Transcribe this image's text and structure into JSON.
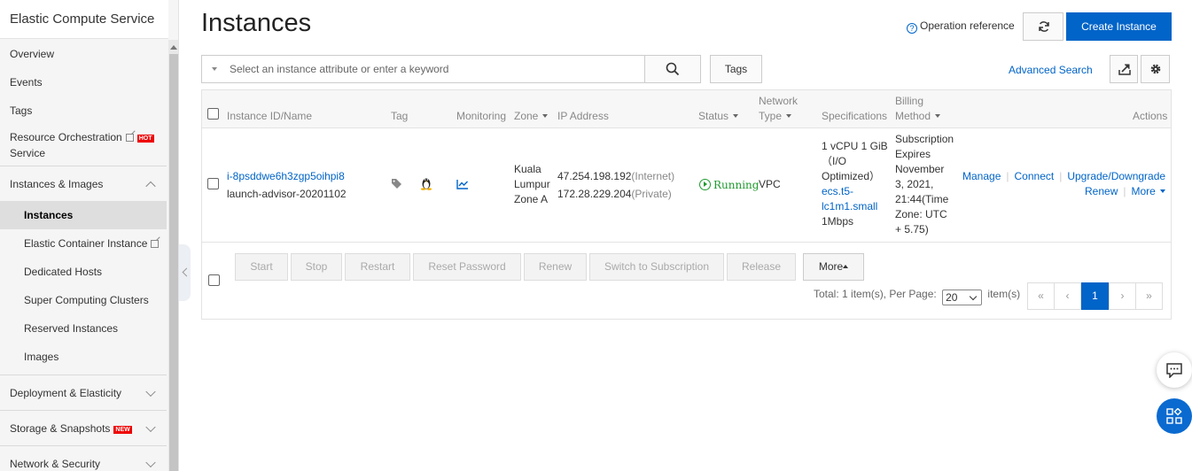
{
  "sidebar": {
    "title": "Elastic Compute Service",
    "items": [
      {
        "label": "Overview"
      },
      {
        "label": "Events"
      },
      {
        "label": "Tags"
      },
      {
        "label": "Resource Orchestration Service",
        "badge": "HOT"
      }
    ],
    "section_instances": {
      "label": "Instances & Images"
    },
    "sub_items": [
      {
        "label": "Instances"
      },
      {
        "label": "Elastic Container Instance"
      },
      {
        "label": "Dedicated Hosts"
      },
      {
        "label": "Super Computing Clusters"
      },
      {
        "label": "Reserved Instances"
      },
      {
        "label": "Images"
      }
    ],
    "section_deployment": {
      "label": "Deployment & Elasticity"
    },
    "section_storage": {
      "label": "Storage & Snapshots",
      "badge": "NEW"
    },
    "section_network": {
      "label": "Network & Security"
    }
  },
  "header": {
    "title": "Instances",
    "operation_reference": "Operation reference",
    "create_instance": "Create Instance"
  },
  "search": {
    "placeholder": "Select an instance attribute or enter a keyword",
    "tags_label": "Tags",
    "advanced_search": "Advanced Search"
  },
  "table": {
    "columns": {
      "instance": "Instance ID/Name",
      "tag": "Tag",
      "monitoring": "Monitoring",
      "zone": "Zone",
      "ip": "IP Address",
      "status": "Status",
      "network_1": "Network",
      "network_2": "Type",
      "specs": "Specifications",
      "billing_1": "Billing",
      "billing_2": "Method",
      "actions": "Actions"
    },
    "row": {
      "instance_id": "i-8psddwe6h3zgp5oihpi8",
      "instance_name": "launch-advisor-20201102",
      "zone_1": "Kuala",
      "zone_2": "Lumpur",
      "zone_3": "Zone A",
      "ip_public": "47.254.198.192",
      "ip_public_tag": "(Internet)",
      "ip_private": "172.28.229.204",
      "ip_private_tag": "(Private)",
      "status": "Running",
      "network_type": "VPC",
      "spec_1": "1 vCPU 1 GiB",
      "spec_2": "（I/O",
      "spec_3": "Optimized）",
      "spec_type_1": "ecs.t5-",
      "spec_type_2": "lc1m1.small",
      "spec_bandwidth": "1Mbps",
      "billing_1": "Subscription",
      "billing_2": "Expires",
      "billing_3": "November",
      "billing_4": "3, 2021,",
      "billing_5": "21:44(Time",
      "billing_6": "Zone: UTC",
      "billing_7": "+ 5.75)",
      "action_manage": "Manage",
      "action_connect": "Connect",
      "action_upgrade": "Upgrade/Downgrade",
      "action_renew": "Renew",
      "action_more": "More"
    },
    "footer": {
      "buttons": [
        "Start",
        "Stop",
        "Restart",
        "Reset Password",
        "Renew",
        "Switch to Subscription",
        "Release"
      ],
      "more": "More",
      "total_text": "Total: 1 item(s), Per Page:",
      "per_page": "20",
      "items_suffix": "item(s)",
      "pager_first": "«",
      "pager_prev": "‹",
      "pager_current": "1",
      "pager_next": "›",
      "pager_last": "»"
    }
  },
  "colors": {
    "brand": "#0064c8",
    "running": "#1f9a2f"
  }
}
